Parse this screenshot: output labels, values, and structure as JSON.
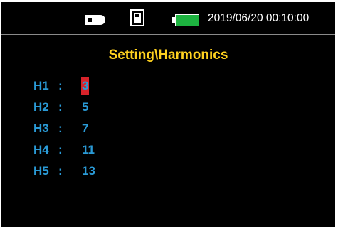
{
  "status_bar": {
    "usb_icon": "usb-drive-icon",
    "network_icon": "ethernet-port-icon",
    "battery_icon": "battery-full-icon",
    "battery_color": "#1db340",
    "datetime": "2019/06/20 00:10:00"
  },
  "page": {
    "title": "Setting\\Harmonics",
    "title_color": "#ffd21f",
    "text_color": "#2a9ad6",
    "selection_color": "#d8232a"
  },
  "harmonics": [
    {
      "label": "H1",
      "colon": ":",
      "value": "3",
      "selected": true
    },
    {
      "label": "H2",
      "colon": ":",
      "value": "5",
      "selected": false
    },
    {
      "label": "H3",
      "colon": ":",
      "value": "7",
      "selected": false
    },
    {
      "label": "H4",
      "colon": ":",
      "value": "11",
      "selected": false
    },
    {
      "label": "H5",
      "colon": ":",
      "value": "13",
      "selected": false
    }
  ]
}
